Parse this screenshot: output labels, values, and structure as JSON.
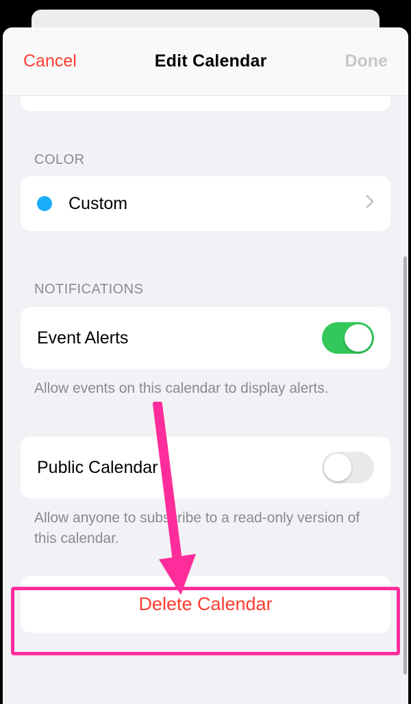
{
  "navbar": {
    "cancel": "Cancel",
    "title": "Edit Calendar",
    "done": "Done"
  },
  "sections": {
    "color": {
      "header": "COLOR",
      "value": "Custom",
      "swatch": "#1badf8"
    },
    "notifications": {
      "header": "NOTIFICATIONS",
      "event_alerts_label": "Event Alerts",
      "event_alerts_on": true,
      "footer": "Allow events on this calendar to display alerts."
    },
    "public": {
      "label": "Public Calendar",
      "on": false,
      "footer": "Allow anyone to subscribe to a read-only version of this calendar."
    },
    "delete": {
      "label": "Delete Calendar"
    }
  }
}
